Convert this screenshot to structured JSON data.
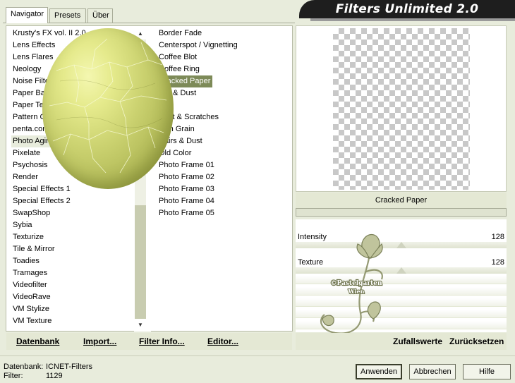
{
  "tabs": [
    {
      "label": "Navigator",
      "active": true
    },
    {
      "label": "Presets",
      "active": false
    },
    {
      "label": "Über",
      "active": false
    }
  ],
  "banner": {
    "title": "Filters Unlimited 2.0"
  },
  "categories": [
    "Krusty's FX vol. II 2.0",
    "Lens Effects",
    "Lens Flares",
    "Neology",
    "Noise Filters",
    "Paper Backgrounds",
    "Paper Textures",
    "Pattern Generators",
    "penta.com",
    "Photo Aging Kit",
    "Pixelate",
    "Psychosis",
    "Render",
    "Special Effects 1",
    "Special Effects 2",
    "SwapShop",
    "Sybia",
    "Texturize",
    "Tile & Mirror",
    "Toadies",
    "Tramages",
    "Videofilter",
    "VideoRave",
    "VM Stylize",
    "VM Texture"
  ],
  "selected_category": "Photo Aging Kit",
  "filters": [
    "Border Fade",
    "Centerspot / Vignetting",
    "Coffee Blot",
    "Coffee Ring",
    "Cracked Paper",
    "Dirt & Dust",
    "Dirt",
    "Dust & Scratches",
    "Film Grain",
    "Hairs & Dust",
    "Old Color",
    "Photo Frame 01",
    "Photo Frame 02",
    "Photo Frame 03",
    "Photo Frame 04",
    "Photo Frame 05"
  ],
  "selected_filter": "Cracked Paper",
  "toolbar": {
    "datenbank": "Datenbank",
    "import": "Import...",
    "filter_info": "Filter Info...",
    "editor": "Editor..."
  },
  "preview": {
    "filter_name": "Cracked Paper"
  },
  "params": [
    {
      "label": "Intensity",
      "value": "128",
      "fraction": 0.5
    },
    {
      "label": "Texture",
      "value": "128",
      "fraction": 0.5
    }
  ],
  "right_toolbar": {
    "random": "Zufallswerte",
    "reset": "Zurücksetzen"
  },
  "watermark": {
    "line1": "©Pastelgarten",
    "line2": "Wien"
  },
  "footer": {
    "db_label": "Datenbank:",
    "db_value": "ICNET-Filters",
    "filter_label": "Filter:",
    "filter_value": "1129"
  },
  "buttons": {
    "apply": "Anwenden",
    "cancel": "Abbrechen",
    "help": "Hilfe"
  },
  "colors": {
    "accent": "#7d8a58",
    "egg": "#cbd270",
    "background": "#e8ecdc"
  }
}
